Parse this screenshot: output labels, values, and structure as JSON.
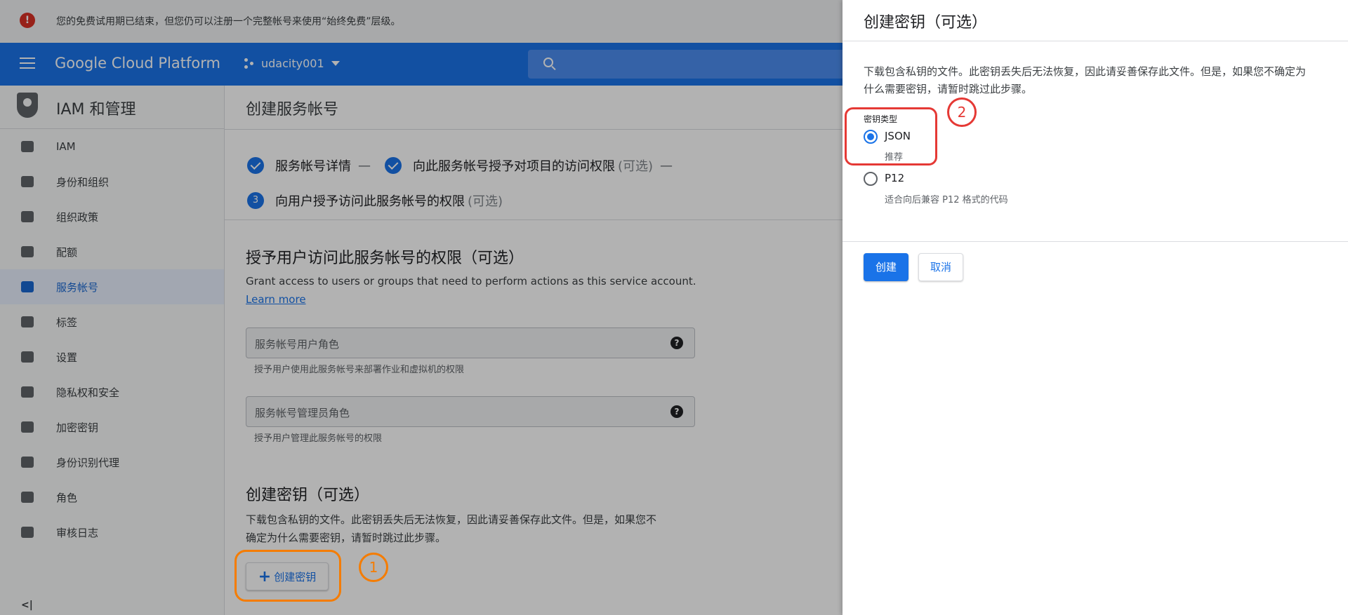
{
  "banner": {
    "text": "您的免费试用期已结束，但您仍可以注册一个完整帐号来使用“始终免费”层级。"
  },
  "header": {
    "brand": "Google Cloud Platform",
    "project": "udacity001"
  },
  "sidebar": {
    "title": "IAM 和管理",
    "items": [
      {
        "label": "IAM",
        "icon": "add-person-icon"
      },
      {
        "label": "身份和组织",
        "icon": "account-circle-icon"
      },
      {
        "label": "组织政策",
        "icon": "document-icon"
      },
      {
        "label": "配额",
        "icon": "quota-icon"
      },
      {
        "label": "服务帐号",
        "icon": "service-account-icon"
      },
      {
        "label": "标签",
        "icon": "tag-icon"
      },
      {
        "label": "设置",
        "icon": "gear-icon"
      },
      {
        "label": "隐私权和安全",
        "icon": "shield-icon"
      },
      {
        "label": "加密密钥",
        "icon": "key-shield-icon"
      },
      {
        "label": "身份识别代理",
        "icon": "proxy-icon"
      },
      {
        "label": "角色",
        "icon": "roles-icon"
      },
      {
        "label": "审核日志",
        "icon": "list-icon"
      }
    ],
    "active_index": 4,
    "collapse_label": "<|"
  },
  "main": {
    "title": "创建服务帐号",
    "steps": [
      {
        "label": "服务帐号详情",
        "optional": ""
      },
      {
        "label": "向此服务帐号授予对项目的访问权限",
        "optional": "(可选)"
      },
      {
        "number": "3",
        "label": "向用户授予访问此服务帐号的权限",
        "optional": "(可选)"
      }
    ],
    "dash": "—",
    "grant": {
      "title": "授予用户访问此服务帐号的权限（可选）",
      "desc": "Grant access to users or groups that need to perform actions as this service account.",
      "learn_more": "Learn more",
      "field1_placeholder": "服务帐号用户角色",
      "field1_hint": "授予用户使用此服务帐号来部署作业和虚拟机的权限",
      "field2_placeholder": "服务帐号管理员角色",
      "field2_hint": "授予用户管理此服务帐号的权限"
    },
    "key": {
      "title": "创建密钥（可选）",
      "desc_line1": "下载包含私钥的文件。此密钥丢失后无法恢复，因此请妥善保存此文件。但是，如果您不",
      "desc_line2": "确定为什么需要密钥，请暂时跳过此步骤。",
      "button": "创建密钥"
    },
    "annotation": "1"
  },
  "panel": {
    "title": "创建密钥（可选）",
    "desc": "下载包含私钥的文件。此密钥丢失后无法恢复，因此请妥善保存此文件。但是，如果您不确定为什么需要密钥，请暂时跳过此步骤。",
    "key_type_label": "密钥类型",
    "options": [
      {
        "label": "JSON",
        "sub": "推荐",
        "checked": true
      },
      {
        "label": "P12",
        "sub": "适合向后兼容 P12 格式的代码",
        "checked": false
      }
    ],
    "create_button": "创建",
    "cancel_button": "取消",
    "annotation": "2"
  },
  "colors": {
    "accent": "#1a73e8",
    "error": "#d93025",
    "annotation_orange": "#f57c00",
    "annotation_red": "#e53935"
  }
}
